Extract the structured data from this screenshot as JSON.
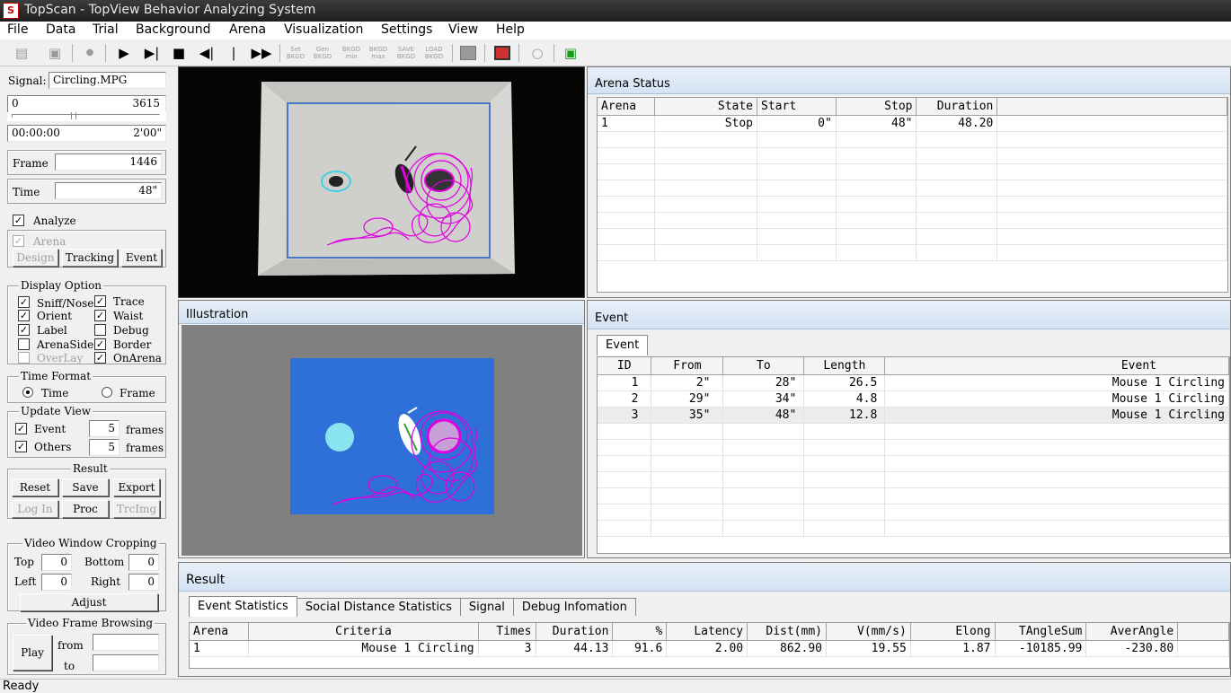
{
  "window": {
    "title": "TopScan - TopView Behavior Analyzing System",
    "app_icon": "topscan-logo-icon"
  },
  "menu": [
    "File",
    "Data",
    "Trial",
    "Background",
    "Arena",
    "Visualization",
    "Settings",
    "View",
    "Help"
  ],
  "toolbar": {
    "small_labels": [
      "Set BKGD",
      "Gen BKGD",
      "BKGD min",
      "BKGD max",
      "SAVE BKGD",
      "LOAD BKGD"
    ]
  },
  "left": {
    "signal_label": "Signal:",
    "signal_value": "Circling.MPG",
    "frame_min": "0",
    "frame_max": "3615",
    "slider_position": 0.4,
    "time_start": "00:00:00",
    "time_end": "2'00\"",
    "frame_label": "Frame",
    "frame_value": "1446",
    "time_label": "Time",
    "time_value": "48\"",
    "analyze_label": "Analyze",
    "arena_label": "Arena",
    "design_label": "Design",
    "tracking_label": "Tracking",
    "event_label": "Event",
    "display_option": {
      "title": "Display Option",
      "items": [
        {
          "label": "Sniff/Nose",
          "checked": true,
          "enabled": true
        },
        {
          "label": "Trace",
          "checked": true,
          "enabled": true
        },
        {
          "label": "Orient",
          "checked": true,
          "enabled": true
        },
        {
          "label": "Waist",
          "checked": true,
          "enabled": true
        },
        {
          "label": "Label",
          "checked": true,
          "enabled": true
        },
        {
          "label": "Debug",
          "checked": false,
          "enabled": true
        },
        {
          "label": "ArenaSide",
          "checked": false,
          "enabled": true
        },
        {
          "label": "Border",
          "checked": true,
          "enabled": true
        },
        {
          "label": "OverLay",
          "checked": false,
          "enabled": false
        },
        {
          "label": "OnArena",
          "checked": true,
          "enabled": true
        }
      ]
    },
    "time_format": {
      "title": "Time Format",
      "time": "Time",
      "frame": "Frame",
      "selected": "Time"
    },
    "update_view": {
      "title": "Update View",
      "event_label": "Event",
      "event_value": "5",
      "others_label": "Others",
      "others_value": "5",
      "unit": "frames"
    },
    "result": {
      "title": "Result",
      "reset": "Reset",
      "save": "Save",
      "export": "Export",
      "login": "Log In",
      "proc": "Proc",
      "trcimg": "TrcImg"
    },
    "cropping": {
      "title": "Video Window Cropping",
      "top_label": "Top",
      "top_value": "0",
      "bottom_label": "Bottom",
      "bottom_value": "0",
      "left_label": "Left",
      "left_value": "0",
      "right_label": "Right",
      "right_value": "0",
      "adjust": "Adjust"
    },
    "browsing": {
      "title": "Video Frame Browsing",
      "play": "Play",
      "from": "from",
      "to": "to"
    }
  },
  "illustration": {
    "title": "Illustration"
  },
  "arena_status": {
    "title": "Arena Status",
    "columns": [
      "Arena",
      "State",
      "Start",
      "Stop",
      "Duration"
    ],
    "rows": [
      [
        "1",
        "Stop",
        "0\"",
        "48\"",
        "48.20"
      ]
    ]
  },
  "event": {
    "title": "Event",
    "tab": "Event",
    "columns": [
      "ID",
      "From",
      "To",
      "Length",
      "Event"
    ],
    "rows": [
      [
        "1",
        "2\"",
        "28\"",
        "26.5",
        "Mouse 1 Circling"
      ],
      [
        "2",
        "29\"",
        "34\"",
        "4.8",
        "Mouse 1 Circling"
      ],
      [
        "3",
        "35\"",
        "48\"",
        "12.8",
        "Mouse 1 Circling"
      ]
    ]
  },
  "result": {
    "title": "Result",
    "tabs": [
      "Event Statistics",
      "Social Distance Statistics",
      "Signal",
      "Debug Infomation"
    ],
    "active_tab": "Event Statistics",
    "columns": [
      "Arena",
      "Criteria",
      "Times",
      "Duration",
      "%",
      "Latency",
      "Dist(mm)",
      "V(mm/s)",
      "Elong",
      "TAngleSum",
      "AverAngle"
    ],
    "rows": [
      [
        "1",
        "Mouse 1 Circling",
        "3",
        "44.13",
        "91.6",
        "2.00",
        "862.90",
        "19.55",
        "1.87",
        "-10185.99",
        "-230.80"
      ]
    ]
  },
  "status": "Ready",
  "colors": {
    "trace": "#e000e0",
    "illustration_bg": "#2e6fd8",
    "arena_border": "#4a78c8",
    "panel_header": "#d3e2f3"
  }
}
